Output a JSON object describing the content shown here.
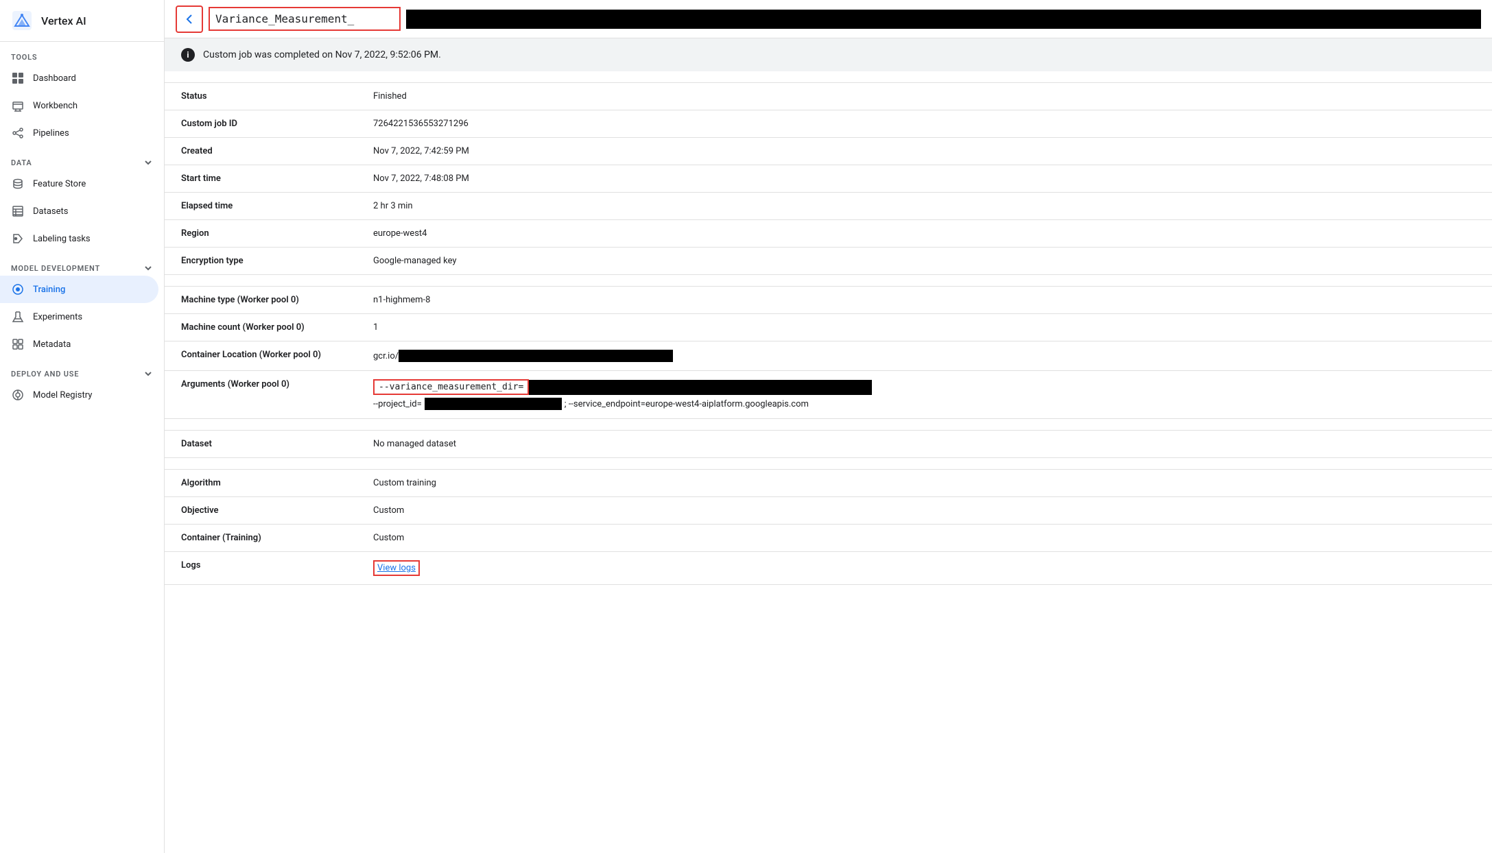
{
  "app": {
    "name": "Vertex AI"
  },
  "sidebar": {
    "tools_label": "TOOLS",
    "data_label": "DATA",
    "model_dev_label": "MODEL DEVELOPMENT",
    "deploy_label": "DEPLOY AND USE",
    "items": {
      "dashboard": "Dashboard",
      "workbench": "Workbench",
      "pipelines": "Pipelines",
      "feature_store": "Feature Store",
      "datasets": "Datasets",
      "labeling_tasks": "Labeling tasks",
      "training": "Training",
      "experiments": "Experiments",
      "metadata": "Metadata",
      "model_registry": "Model Registry"
    }
  },
  "header": {
    "page_title_prefix": "Variance_Measurement_"
  },
  "banner": {
    "message": "Custom job was completed on Nov 7, 2022, 9:52:06 PM."
  },
  "details": {
    "status_label": "Status",
    "status_value": "Finished",
    "custom_job_id_label": "Custom job ID",
    "custom_job_id_value": "7264221536553271296",
    "created_label": "Created",
    "created_value": "Nov 7, 2022, 7:42:59 PM",
    "start_time_label": "Start time",
    "start_time_value": "Nov 7, 2022, 7:48:08 PM",
    "elapsed_time_label": "Elapsed time",
    "elapsed_time_value": "2 hr 3 min",
    "region_label": "Region",
    "region_value": "europe-west4",
    "encryption_type_label": "Encryption type",
    "encryption_type_value": "Google-managed key",
    "machine_type_label": "Machine type (Worker pool 0)",
    "machine_type_value": "n1-highmem-8",
    "machine_count_label": "Machine count (Worker pool 0)",
    "machine_count_value": "1",
    "container_location_label": "Container Location (Worker pool 0)",
    "container_location_prefix": "gcr.io/",
    "arguments_label": "Arguments (Worker pool 0)",
    "arguments_part1": "--variance_measurement_dir=",
    "arguments_part2": "--project_id=",
    "arguments_part2_suffix": "; --service_endpoint=europe-west4-aiplatform.googleapis.com",
    "dataset_label": "Dataset",
    "dataset_value": "No managed dataset",
    "algorithm_label": "Algorithm",
    "algorithm_value": "Custom training",
    "objective_label": "Objective",
    "objective_value": "Custom",
    "container_training_label": "Container (Training)",
    "container_training_value": "Custom",
    "logs_label": "Logs",
    "logs_link": "View logs"
  }
}
